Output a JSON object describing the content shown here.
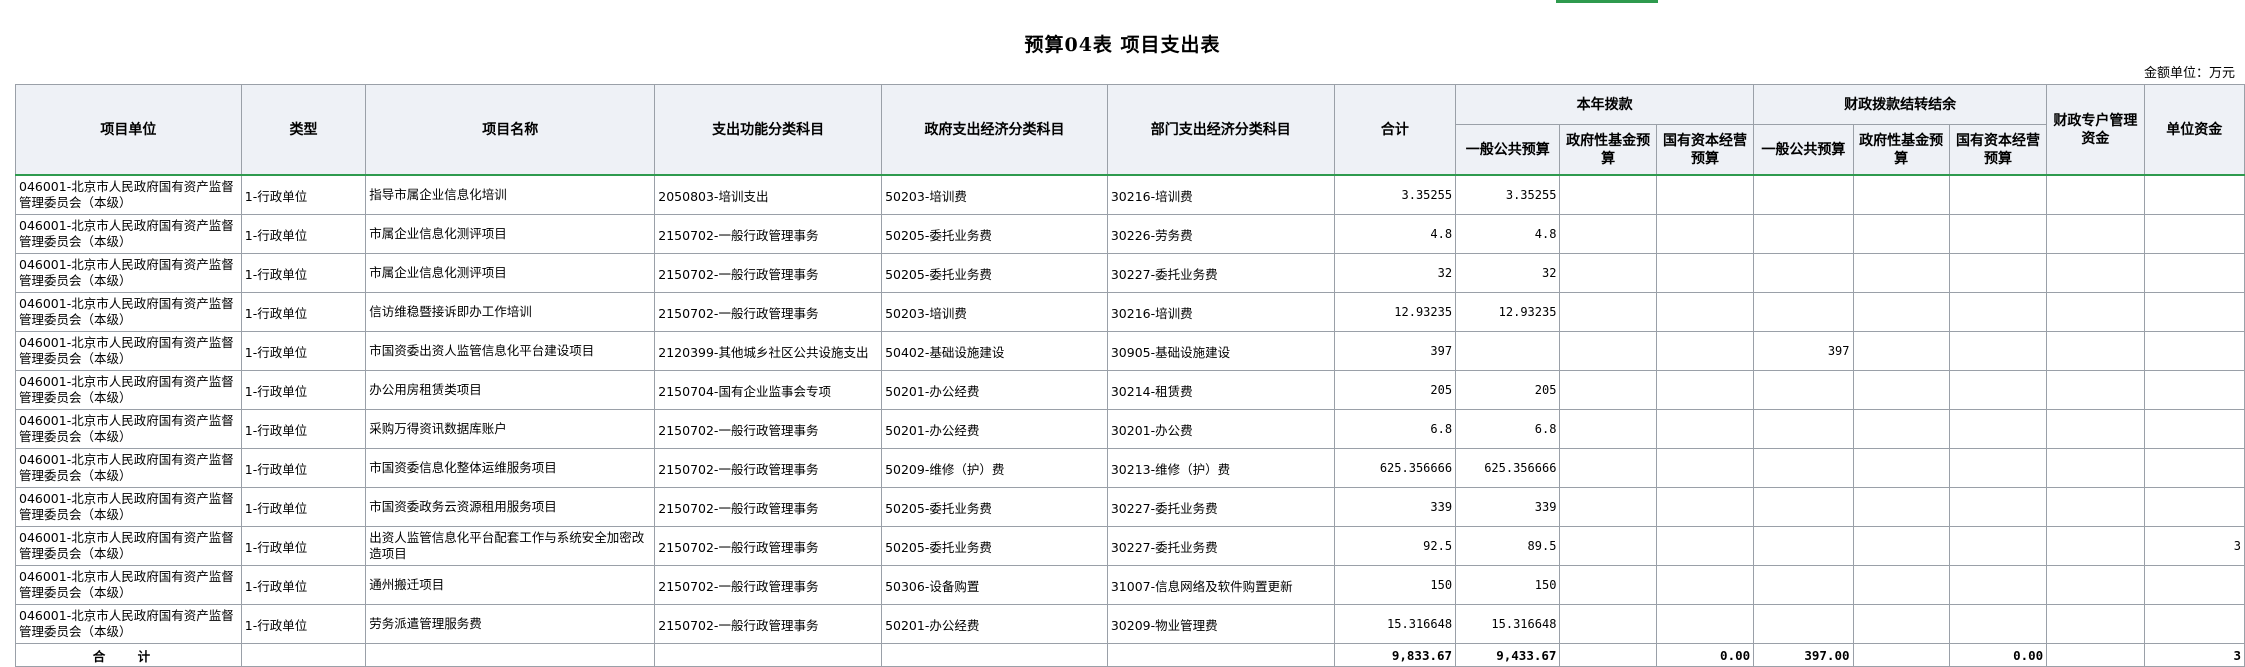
{
  "title": "预算04表  项目支出表",
  "unit_label": "金额单位：万元",
  "headers": {
    "unit": "项目单位",
    "type": "类型",
    "project": "项目名称",
    "func": "支出功能分类科目",
    "gov": "政府支出经济分类科目",
    "dept": "部门支出经济分类科目",
    "total": "合计",
    "group_current": "本年拨款",
    "group_carry": "财政拨款结转结余",
    "cur_general": "一般公共预算",
    "cur_fund": "政府性基金预算",
    "cur_capital": "国有资本经营预算",
    "carry_general": "一般公共预算",
    "carry_fund": "政府性基金预算",
    "carry_capital": "国有资本经营预算",
    "special": "财政专户管理资金",
    "self": "单位资金"
  },
  "rows": [
    {
      "unit": "046001-北京市人民政府国有资产监督管理委员会（本级）",
      "type": "1-行政单位",
      "project": "指导市属企业信息化培训",
      "func": "2050803-培训支出",
      "gov": "50203-培训费",
      "dept": "30216-培训费",
      "total": "3.35255",
      "cur_general": "3.35255",
      "cur_fund": "",
      "cur_capital": "",
      "carry_general": "",
      "carry_fund": "",
      "carry_capital": "",
      "special": "",
      "self": ""
    },
    {
      "unit": "046001-北京市人民政府国有资产监督管理委员会（本级）",
      "type": "1-行政单位",
      "project": "市属企业信息化测评项目",
      "func": "2150702-一般行政管理事务",
      "gov": "50205-委托业务费",
      "dept": "30226-劳务费",
      "total": "4.8",
      "cur_general": "4.8",
      "cur_fund": "",
      "cur_capital": "",
      "carry_general": "",
      "carry_fund": "",
      "carry_capital": "",
      "special": "",
      "self": ""
    },
    {
      "unit": "046001-北京市人民政府国有资产监督管理委员会（本级）",
      "type": "1-行政单位",
      "project": "市属企业信息化测评项目",
      "func": "2150702-一般行政管理事务",
      "gov": "50205-委托业务费",
      "dept": "30227-委托业务费",
      "total": "32",
      "cur_general": "32",
      "cur_fund": "",
      "cur_capital": "",
      "carry_general": "",
      "carry_fund": "",
      "carry_capital": "",
      "special": "",
      "self": ""
    },
    {
      "unit": "046001-北京市人民政府国有资产监督管理委员会（本级）",
      "type": "1-行政单位",
      "project": "信访维稳暨接诉即办工作培训",
      "func": "2150702-一般行政管理事务",
      "gov": "50203-培训费",
      "dept": "30216-培训费",
      "total": "12.93235",
      "cur_general": "12.93235",
      "cur_fund": "",
      "cur_capital": "",
      "carry_general": "",
      "carry_fund": "",
      "carry_capital": "",
      "special": "",
      "self": ""
    },
    {
      "unit": "046001-北京市人民政府国有资产监督管理委员会（本级）",
      "type": "1-行政单位",
      "project": "市国资委出资人监管信息化平台建设项目",
      "func": "2120399-其他城乡社区公共设施支出",
      "gov": "50402-基础设施建设",
      "dept": "30905-基础设施建设",
      "total": "397",
      "cur_general": "",
      "cur_fund": "",
      "cur_capital": "",
      "carry_general": "397",
      "carry_fund": "",
      "carry_capital": "",
      "special": "",
      "self": ""
    },
    {
      "unit": "046001-北京市人民政府国有资产监督管理委员会（本级）",
      "type": "1-行政单位",
      "project": "办公用房租赁类项目",
      "func": "2150704-国有企业监事会专项",
      "gov": "50201-办公经费",
      "dept": "30214-租赁费",
      "total": "205",
      "cur_general": "205",
      "cur_fund": "",
      "cur_capital": "",
      "carry_general": "",
      "carry_fund": "",
      "carry_capital": "",
      "special": "",
      "self": ""
    },
    {
      "unit": "046001-北京市人民政府国有资产监督管理委员会（本级）",
      "type": "1-行政单位",
      "project": "采购万得资讯数据库账户",
      "func": "2150702-一般行政管理事务",
      "gov": "50201-办公经费",
      "dept": "30201-办公费",
      "total": "6.8",
      "cur_general": "6.8",
      "cur_fund": "",
      "cur_capital": "",
      "carry_general": "",
      "carry_fund": "",
      "carry_capital": "",
      "special": "",
      "self": ""
    },
    {
      "unit": "046001-北京市人民政府国有资产监督管理委员会（本级）",
      "type": "1-行政单位",
      "project": "市国资委信息化整体运维服务项目",
      "func": "2150702-一般行政管理事务",
      "gov": "50209-维修（护）费",
      "dept": "30213-维修（护）费",
      "total": "625.356666",
      "cur_general": "625.356666",
      "cur_fund": "",
      "cur_capital": "",
      "carry_general": "",
      "carry_fund": "",
      "carry_capital": "",
      "special": "",
      "self": ""
    },
    {
      "unit": "046001-北京市人民政府国有资产监督管理委员会（本级）",
      "type": "1-行政单位",
      "project": "市国资委政务云资源租用服务项目",
      "func": "2150702-一般行政管理事务",
      "gov": "50205-委托业务费",
      "dept": "30227-委托业务费",
      "total": "339",
      "cur_general": "339",
      "cur_fund": "",
      "cur_capital": "",
      "carry_general": "",
      "carry_fund": "",
      "carry_capital": "",
      "special": "",
      "self": ""
    },
    {
      "unit": "046001-北京市人民政府国有资产监督管理委员会（本级）",
      "type": "1-行政单位",
      "project": "出资人监管信息化平台配套工作与系统安全加密改造项目",
      "func": "2150702-一般行政管理事务",
      "gov": "50205-委托业务费",
      "dept": "30227-委托业务费",
      "total": "92.5",
      "cur_general": "89.5",
      "cur_fund": "",
      "cur_capital": "",
      "carry_general": "",
      "carry_fund": "",
      "carry_capital": "",
      "special": "",
      "self": "3"
    },
    {
      "unit": "046001-北京市人民政府国有资产监督管理委员会（本级）",
      "type": "1-行政单位",
      "project": "通州搬迁项目",
      "func": "2150702-一般行政管理事务",
      "gov": "50306-设备购置",
      "dept": "31007-信息网络及软件购置更新",
      "total": "150",
      "cur_general": "150",
      "cur_fund": "",
      "cur_capital": "",
      "carry_general": "",
      "carry_fund": "",
      "carry_capital": "",
      "special": "",
      "self": ""
    },
    {
      "unit": "046001-北京市人民政府国有资产监督管理委员会（本级）",
      "type": "1-行政单位",
      "project": "劳务派遣管理服务费",
      "func": "2150702-一般行政管理事务",
      "gov": "50201-办公经费",
      "dept": "30209-物业管理费",
      "total": "15.316648",
      "cur_general": "15.316648",
      "cur_fund": "",
      "cur_capital": "",
      "carry_general": "",
      "carry_fund": "",
      "carry_capital": "",
      "special": "",
      "self": ""
    }
  ],
  "totals": {
    "label": "合 计",
    "total": "9,833.67",
    "cur_general": "9,433.67",
    "cur_fund": "",
    "cur_capital": "0.00",
    "carry_general": "397.00",
    "carry_fund": "",
    "carry_capital": "0.00",
    "special": "",
    "self": "3"
  }
}
